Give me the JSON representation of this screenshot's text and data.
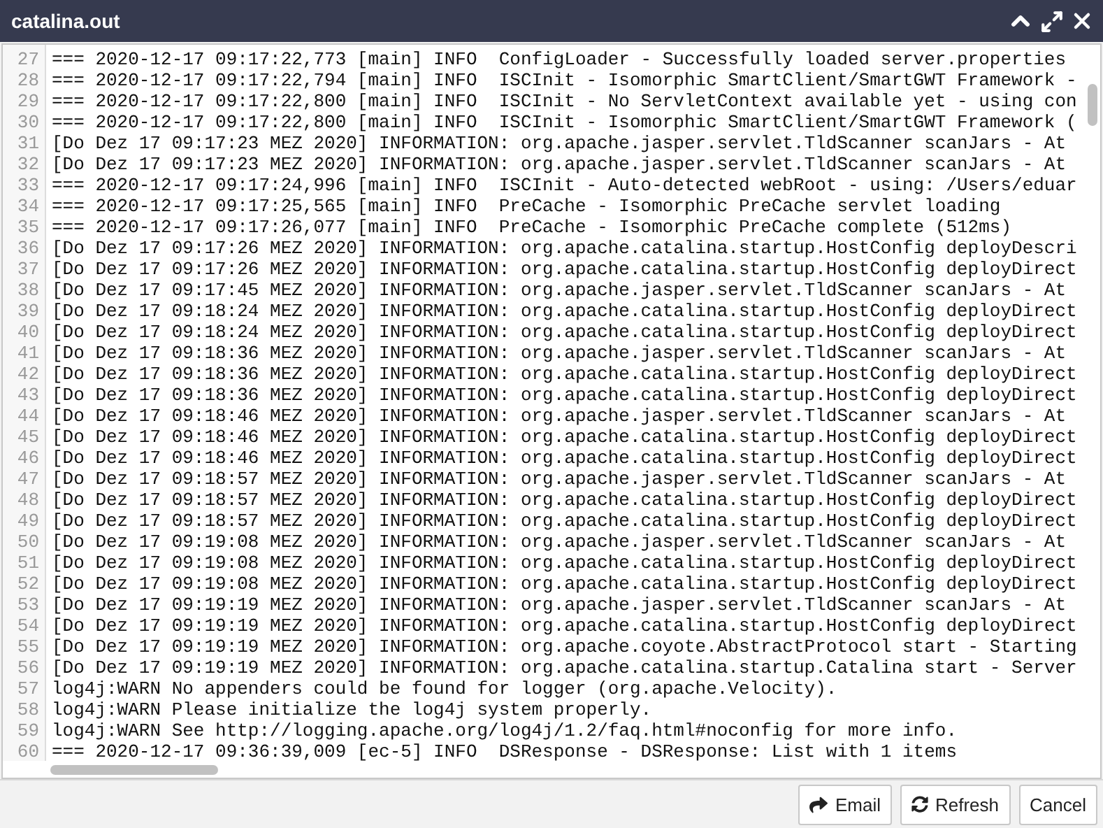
{
  "window": {
    "title": "catalina.out"
  },
  "log_lines": [
    {
      "number": "27",
      "text": "=== 2020-12-17 09:17:22,773 [main] INFO  ConfigLoader - Successfully loaded server.properties"
    },
    {
      "number": "28",
      "text": "=== 2020-12-17 09:17:22,794 [main] INFO  ISCInit - Isomorphic SmartClient/SmartGWT Framework -"
    },
    {
      "number": "29",
      "text": "=== 2020-12-17 09:17:22,800 [main] INFO  ISCInit - No ServletContext available yet - using con"
    },
    {
      "number": "30",
      "text": "=== 2020-12-17 09:17:22,800 [main] INFO  ISCInit - Isomorphic SmartClient/SmartGWT Framework ("
    },
    {
      "number": "31",
      "text": "[Do Dez 17 09:17:23 MEZ 2020] INFORMATION: org.apache.jasper.servlet.TldScanner scanJars - At"
    },
    {
      "number": "32",
      "text": "[Do Dez 17 09:17:23 MEZ 2020] INFORMATION: org.apache.jasper.servlet.TldScanner scanJars - At"
    },
    {
      "number": "33",
      "text": "=== 2020-12-17 09:17:24,996 [main] INFO  ISCInit - Auto-detected webRoot - using: /Users/eduar"
    },
    {
      "number": "34",
      "text": "=== 2020-12-17 09:17:25,565 [main] INFO  PreCache - Isomorphic PreCache servlet loading"
    },
    {
      "number": "35",
      "text": "=== 2020-12-17 09:17:26,077 [main] INFO  PreCache - Isomorphic PreCache complete (512ms)"
    },
    {
      "number": "36",
      "text": "[Do Dez 17 09:17:26 MEZ 2020] INFORMATION: org.apache.catalina.startup.HostConfig deployDescri"
    },
    {
      "number": "37",
      "text": "[Do Dez 17 09:17:26 MEZ 2020] INFORMATION: org.apache.catalina.startup.HostConfig deployDirect"
    },
    {
      "number": "38",
      "text": "[Do Dez 17 09:17:45 MEZ 2020] INFORMATION: org.apache.jasper.servlet.TldScanner scanJars - At"
    },
    {
      "number": "39",
      "text": "[Do Dez 17 09:18:24 MEZ 2020] INFORMATION: org.apache.catalina.startup.HostConfig deployDirect"
    },
    {
      "number": "40",
      "text": "[Do Dez 17 09:18:24 MEZ 2020] INFORMATION: org.apache.catalina.startup.HostConfig deployDirect"
    },
    {
      "number": "41",
      "text": "[Do Dez 17 09:18:36 MEZ 2020] INFORMATION: org.apache.jasper.servlet.TldScanner scanJars - At"
    },
    {
      "number": "42",
      "text": "[Do Dez 17 09:18:36 MEZ 2020] INFORMATION: org.apache.catalina.startup.HostConfig deployDirect"
    },
    {
      "number": "43",
      "text": "[Do Dez 17 09:18:36 MEZ 2020] INFORMATION: org.apache.catalina.startup.HostConfig deployDirect"
    },
    {
      "number": "44",
      "text": "[Do Dez 17 09:18:46 MEZ 2020] INFORMATION: org.apache.jasper.servlet.TldScanner scanJars - At"
    },
    {
      "number": "45",
      "text": "[Do Dez 17 09:18:46 MEZ 2020] INFORMATION: org.apache.catalina.startup.HostConfig deployDirect"
    },
    {
      "number": "46",
      "text": "[Do Dez 17 09:18:46 MEZ 2020] INFORMATION: org.apache.catalina.startup.HostConfig deployDirect"
    },
    {
      "number": "47",
      "text": "[Do Dez 17 09:18:57 MEZ 2020] INFORMATION: org.apache.jasper.servlet.TldScanner scanJars - At"
    },
    {
      "number": "48",
      "text": "[Do Dez 17 09:18:57 MEZ 2020] INFORMATION: org.apache.catalina.startup.HostConfig deployDirect"
    },
    {
      "number": "49",
      "text": "[Do Dez 17 09:18:57 MEZ 2020] INFORMATION: org.apache.catalina.startup.HostConfig deployDirect"
    },
    {
      "number": "50",
      "text": "[Do Dez 17 09:19:08 MEZ 2020] INFORMATION: org.apache.jasper.servlet.TldScanner scanJars - At"
    },
    {
      "number": "51",
      "text": "[Do Dez 17 09:19:08 MEZ 2020] INFORMATION: org.apache.catalina.startup.HostConfig deployDirect"
    },
    {
      "number": "52",
      "text": "[Do Dez 17 09:19:08 MEZ 2020] INFORMATION: org.apache.catalina.startup.HostConfig deployDirect"
    },
    {
      "number": "53",
      "text": "[Do Dez 17 09:19:19 MEZ 2020] INFORMATION: org.apache.jasper.servlet.TldScanner scanJars - At"
    },
    {
      "number": "54",
      "text": "[Do Dez 17 09:19:19 MEZ 2020] INFORMATION: org.apache.catalina.startup.HostConfig deployDirect"
    },
    {
      "number": "55",
      "text": "[Do Dez 17 09:19:19 MEZ 2020] INFORMATION: org.apache.coyote.AbstractProtocol start - Starting"
    },
    {
      "number": "56",
      "text": "[Do Dez 17 09:19:19 MEZ 2020] INFORMATION: org.apache.catalina.startup.Catalina start - Server"
    },
    {
      "number": "57",
      "text": "log4j:WARN No appenders could be found for logger (org.apache.Velocity)."
    },
    {
      "number": "58",
      "text": "log4j:WARN Please initialize the log4j system properly."
    },
    {
      "number": "59",
      "text": "log4j:WARN See http://logging.apache.org/log4j/1.2/faq.html#noconfig for more info."
    },
    {
      "number": "60",
      "text": "=== 2020-12-17 09:36:39,009 [ec-5] INFO  DSResponse - DSResponse: List with 1 items"
    }
  ],
  "buttons": [
    {
      "label": "Email",
      "kind": "email"
    },
    {
      "label": "Refresh",
      "kind": "refresh"
    },
    {
      "label": "Cancel",
      "kind": "cancel"
    }
  ]
}
